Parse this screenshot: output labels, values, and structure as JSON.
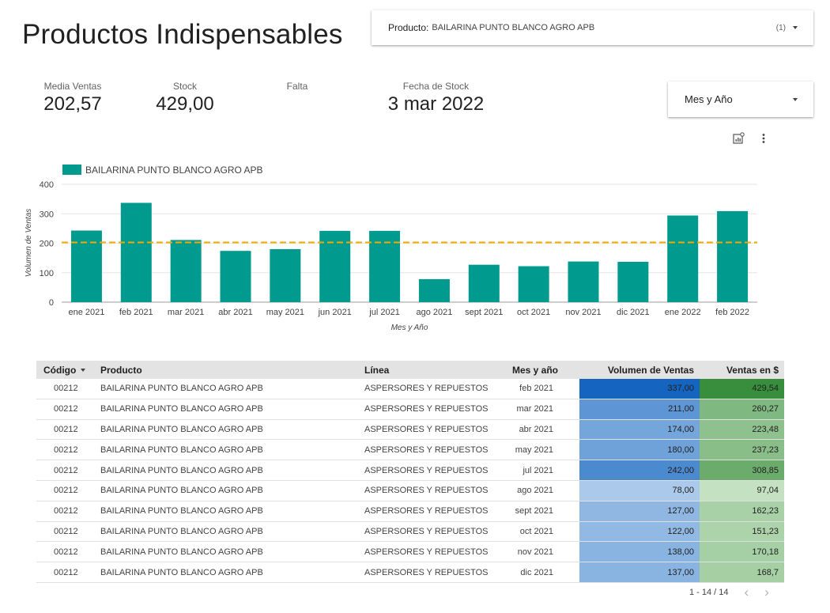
{
  "page": {
    "title": "Productos Indispensables"
  },
  "product_filter": {
    "label": "Producto:",
    "value": "BAILARINA PUNTO BLANCO AGRO APB",
    "count": "(1)"
  },
  "month_filter": {
    "label": "Mes y Año"
  },
  "kpis": {
    "media_ventas": {
      "label": "Media Ventas",
      "value": "202,57"
    },
    "stock": {
      "label": "Stock",
      "value": "429,00"
    },
    "falta": {
      "label": "Falta",
      "value": ""
    },
    "fecha_stock": {
      "label": "Fecha de Stock",
      "value": "3 mar 2022"
    }
  },
  "chart_data": {
    "type": "bar",
    "categories": [
      "ene 2021",
      "feb 2021",
      "mar 2021",
      "abr 2021",
      "may 2021",
      "jun 2021",
      "jul 2021",
      "ago 2021",
      "sept 2021",
      "oct 2021",
      "nov 2021",
      "dic 2021",
      "ene 2022",
      "feb 2022"
    ],
    "series": [
      {
        "name": "BAILARINA PUNTO BLANCO AGRO APB",
        "values": [
          243,
          337,
          211,
          174,
          180,
          242,
          242,
          78,
          127,
          122,
          138,
          137,
          294,
          309
        ],
        "color": "#009b8e"
      }
    ],
    "reference_line": {
      "value": 202.57,
      "color": "#f2a900",
      "style": "dashed"
    },
    "xlabel": "Mes y Año",
    "ylabel": "Volumen de Ventas",
    "ylim": [
      0,
      400
    ],
    "yticks": [
      "0",
      "100",
      "200",
      "300",
      "400"
    ],
    "grid": true,
    "legend_position": "top-left"
  },
  "table": {
    "columns": [
      "Código",
      "Producto",
      "Línea",
      "Mes y año",
      "Volumen de Ventas",
      "Ventas en $"
    ],
    "rows": [
      {
        "code": "00212",
        "product": "BAILARINA PUNTO BLANCO AGRO APB",
        "line": "ASPERSORES Y REPUESTOS",
        "month": "feb 2021",
        "volume": "337,00",
        "sales": "429,54"
      },
      {
        "code": "00212",
        "product": "BAILARINA PUNTO BLANCO AGRO APB",
        "line": "ASPERSORES Y REPUESTOS",
        "month": "mar 2021",
        "volume": "211,00",
        "sales": "260,27"
      },
      {
        "code": "00212",
        "product": "BAILARINA PUNTO BLANCO AGRO APB",
        "line": "ASPERSORES Y REPUESTOS",
        "month": "abr 2021",
        "volume": "174,00",
        "sales": "223,48"
      },
      {
        "code": "00212",
        "product": "BAILARINA PUNTO BLANCO AGRO APB",
        "line": "ASPERSORES Y REPUESTOS",
        "month": "may 2021",
        "volume": "180,00",
        "sales": "237,23"
      },
      {
        "code": "00212",
        "product": "BAILARINA PUNTO BLANCO AGRO APB",
        "line": "ASPERSORES Y REPUESTOS",
        "month": "jul 2021",
        "volume": "242,00",
        "sales": "308,85"
      },
      {
        "code": "00212",
        "product": "BAILARINA PUNTO BLANCO AGRO APB",
        "line": "ASPERSORES Y REPUESTOS",
        "month": "ago 2021",
        "volume": "78,00",
        "sales": "97,04"
      },
      {
        "code": "00212",
        "product": "BAILARINA PUNTO BLANCO AGRO APB",
        "line": "ASPERSORES Y REPUESTOS",
        "month": "sept 2021",
        "volume": "127,00",
        "sales": "162,23"
      },
      {
        "code": "00212",
        "product": "BAILARINA PUNTO BLANCO AGRO APB",
        "line": "ASPERSORES Y REPUESTOS",
        "month": "oct 2021",
        "volume": "122,00",
        "sales": "151,23"
      },
      {
        "code": "00212",
        "product": "BAILARINA PUNTO BLANCO AGRO APB",
        "line": "ASPERSORES Y REPUESTOS",
        "month": "nov 2021",
        "volume": "138,00",
        "sales": "170,18"
      },
      {
        "code": "00212",
        "product": "BAILARINA PUNTO BLANCO AGRO APB",
        "line": "ASPERSORES Y REPUESTOS",
        "month": "dic 2021",
        "volume": "137,00",
        "sales": "168,7"
      }
    ],
    "heat_colors": {
      "volume": "#1565c0",
      "sales": "#388e3c"
    }
  },
  "pagination": {
    "label": "1 - 14 / 14"
  }
}
